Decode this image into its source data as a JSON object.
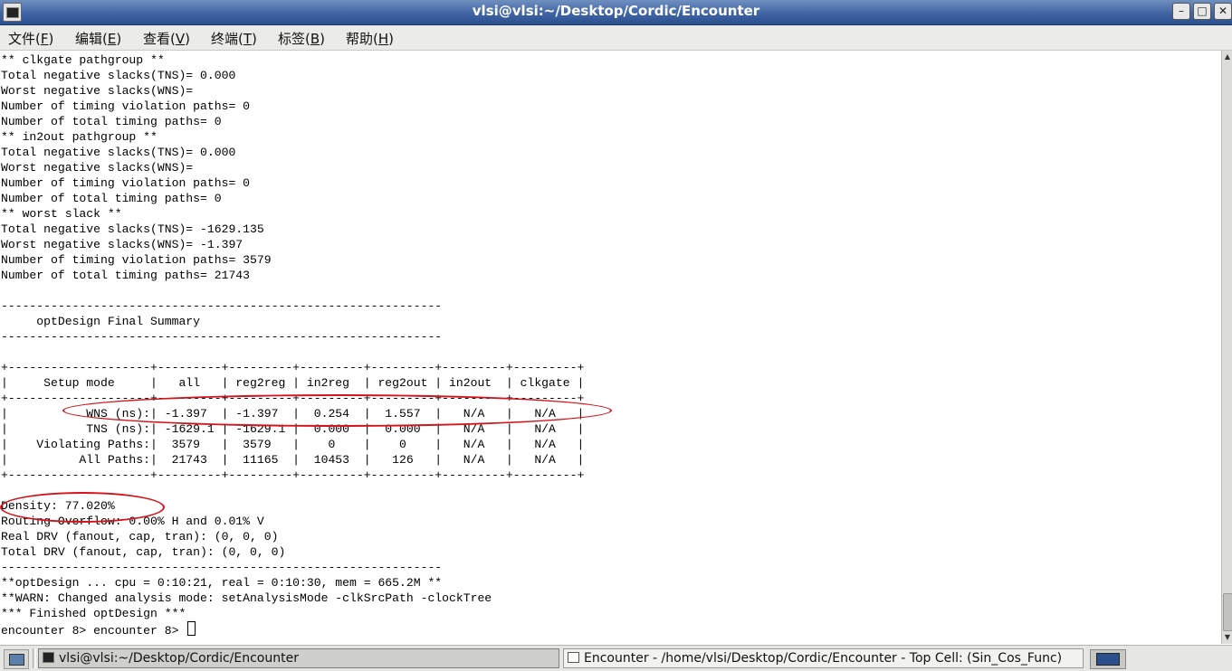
{
  "window": {
    "title": "vlsi@vlsi:~/Desktop/Cordic/Encounter",
    "minimize": "–",
    "maximize": "□",
    "close": "✕"
  },
  "menu": [
    {
      "label": "文件(",
      "key": "F",
      "end": ")"
    },
    {
      "label": "编辑(",
      "key": "E",
      "end": ")"
    },
    {
      "label": "查看(",
      "key": "V",
      "end": ")"
    },
    {
      "label": "终端(",
      "key": "T",
      "end": ")"
    },
    {
      "label": "标签(",
      "key": "B",
      "end": ")"
    },
    {
      "label": "帮助(",
      "key": "H",
      "end": ")"
    }
  ],
  "terminal": {
    "lines": [
      "** clkgate pathgroup **",
      "Total negative slacks(TNS)= 0.000",
      "Worst negative slacks(WNS)=",
      "Number of timing violation paths= 0",
      "Number of total timing paths= 0",
      "** in2out pathgroup **",
      "Total negative slacks(TNS)= 0.000",
      "Worst negative slacks(WNS)=",
      "Number of timing violation paths= 0",
      "Number of total timing paths= 0",
      "** worst slack **",
      "Total negative slacks(TNS)= -1629.135",
      "Worst negative slacks(WNS)= -1.397",
      "Number of timing violation paths= 3579",
      "Number of total timing paths= 21743",
      "",
      "--------------------------------------------------------------",
      "     optDesign Final Summary",
      "--------------------------------------------------------------",
      "",
      "+--------------------+---------+---------+---------+---------+---------+---------+",
      "|     Setup mode     |   all   | reg2reg | in2reg  | reg2out | in2out  | clkgate |",
      "+--------------------+---------+---------+---------+---------+---------+---------+",
      "|           WNS (ns):| -1.397  | -1.397  |  0.254  |  1.557  |   N/A   |   N/A   |",
      "|           TNS (ns):| -1629.1 | -1629.1 |  0.000  |  0.000  |   N/A   |   N/A   |",
      "|    Violating Paths:|  3579   |  3579   |    0    |    0    |   N/A   |   N/A   |",
      "|          All Paths:|  21743  |  11165  |  10453  |   126   |   N/A   |   N/A   |",
      "+--------------------+---------+---------+---------+---------+---------+---------+",
      "",
      "Density: 77.020%",
      "Routing Overflow: 0.00% H and 0.01% V",
      "Real DRV (fanout, cap, tran): (0, 0, 0)",
      "Total DRV (fanout, cap, tran): (0, 0, 0)",
      "--------------------------------------------------------------",
      "**optDesign ... cpu = 0:10:21, real = 0:10:30, mem = 665.2M **",
      "**WARN: Changed analysis mode: setAnalysisMode -clkSrcPath -clockTree",
      "*** Finished optDesign ***"
    ],
    "prompt": "encounter 8> encounter 8> "
  },
  "taskbar": {
    "tasks": [
      {
        "label": "vlsi@vlsi:~/Desktop/Cordic/Encounter",
        "active": true
      },
      {
        "label": "Encounter - /home/vlsi/Desktop/Cordic/Encounter - Top Cell: (Sin_Cos_Func)",
        "active": false
      }
    ]
  },
  "annotation_color": "#d4141c"
}
